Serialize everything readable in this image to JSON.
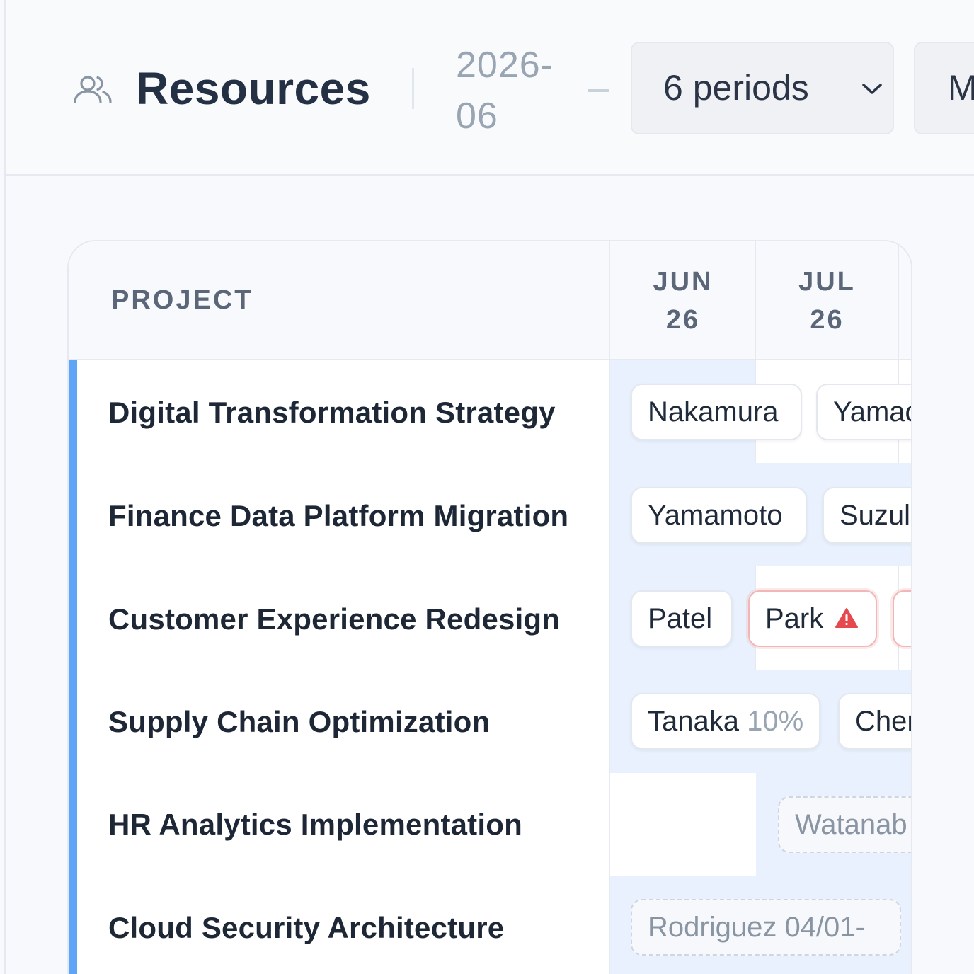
{
  "header": {
    "title": "Resources",
    "date_start": "2026-06",
    "period_select": "6 periods",
    "more_button_partial": "M"
  },
  "table": {
    "project_header": "PROJECT",
    "columns": [
      {
        "month": "JUN",
        "year": "26"
      },
      {
        "month": "JUL",
        "year": "26"
      }
    ],
    "rows": [
      {
        "name": "Digital Transformation Strategy",
        "chips": [
          {
            "label": "Nakamura"
          },
          {
            "label": "Yamac"
          }
        ]
      },
      {
        "name": "Finance Data Platform Migration",
        "chips": [
          {
            "label": "Yamamoto"
          },
          {
            "label": "Suzul"
          }
        ]
      },
      {
        "name": "Customer Experience Redesign",
        "chips": [
          {
            "label": "Patel"
          },
          {
            "label": "Park",
            "warning": true
          },
          {
            "label": ""
          }
        ]
      },
      {
        "name": "Supply Chain Optimization",
        "chips": [
          {
            "label": "Tanaka",
            "pct": "10%"
          },
          {
            "label": "Cher"
          }
        ]
      },
      {
        "name": "HR Analytics Implementation",
        "chips": [
          {
            "label": "Watanab",
            "tentative": true
          }
        ]
      },
      {
        "name": "Cloud Security Architecture",
        "chips": [
          {
            "label": "Rodriguez 04/01-",
            "tentative": true
          }
        ]
      }
    ]
  },
  "colors": {
    "accent_bar": "#5ea5f7",
    "highlight_cell": "#e8f1fd",
    "warning": "#e5484d"
  },
  "icons": [
    "users-icon",
    "chevron-down-icon",
    "warning-triangle-icon"
  ]
}
